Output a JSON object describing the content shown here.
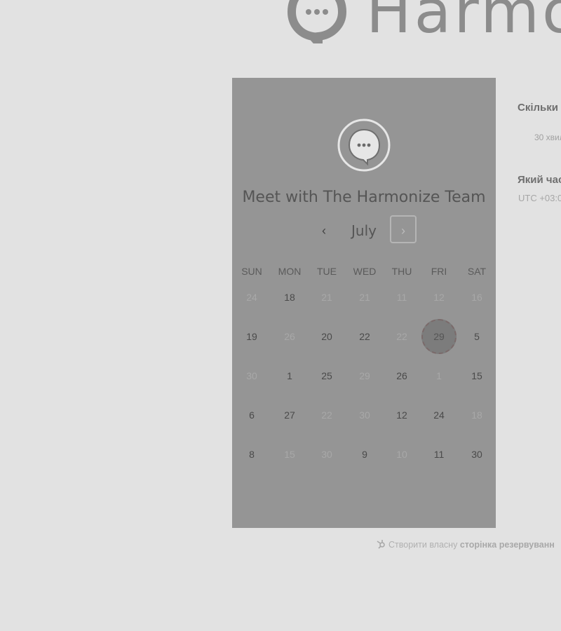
{
  "header": {
    "brand_text": "Harmo",
    "logo_icon": "chat-bubble-icon"
  },
  "card": {
    "title": "Meet with The Harmonize Team",
    "avatar_icon": "chat-bubble-icon",
    "month": "July",
    "prev_icon": "chevron-left-icon",
    "next_icon": "chevron-right-icon",
    "weekdays": [
      "SUN",
      "MON",
      "TUE",
      "WED",
      "THU",
      "FRI",
      "SAT"
    ],
    "weeks": [
      [
        {
          "d": "24",
          "on": false
        },
        {
          "d": "18",
          "on": true
        },
        {
          "d": "21",
          "on": false
        },
        {
          "d": "21",
          "on": false
        },
        {
          "d": "11",
          "on": false
        },
        {
          "d": "12",
          "on": false
        },
        {
          "d": "16",
          "on": false
        }
      ],
      [
        {
          "d": "19",
          "on": true
        },
        {
          "d": "26",
          "on": false
        },
        {
          "d": "20",
          "on": true
        },
        {
          "d": "22",
          "on": true
        },
        {
          "d": "22",
          "on": false
        },
        {
          "d": "29",
          "on": true,
          "selected": true
        },
        {
          "d": "5",
          "on": true
        }
      ],
      [
        {
          "d": "30",
          "on": false
        },
        {
          "d": "1",
          "on": true
        },
        {
          "d": "25",
          "on": true
        },
        {
          "d": "29",
          "on": false
        },
        {
          "d": "26",
          "on": true
        },
        {
          "d": "1",
          "on": false
        },
        {
          "d": "15",
          "on": true
        }
      ],
      [
        {
          "d": "6",
          "on": true
        },
        {
          "d": "27",
          "on": true
        },
        {
          "d": "22",
          "on": false
        },
        {
          "d": "30",
          "on": false
        },
        {
          "d": "12",
          "on": true
        },
        {
          "d": "24",
          "on": true
        },
        {
          "d": "18",
          "on": false
        }
      ],
      [
        {
          "d": "8",
          "on": true
        },
        {
          "d": "15",
          "on": false
        },
        {
          "d": "30",
          "on": false
        },
        {
          "d": "9",
          "on": true
        },
        {
          "d": "10",
          "on": false
        },
        {
          "d": "11",
          "on": true
        },
        {
          "d": "30",
          "on": true
        }
      ]
    ]
  },
  "panel": {
    "question_duration": "Скільки",
    "duration_option": "30 хвил",
    "question_time": "Який час",
    "timezone": "UTC +03:0"
  },
  "footer": {
    "icon": "sprocket-icon",
    "text": "Створити власну",
    "bold_text": "сторінка резервуванн"
  },
  "colors": {
    "page_bg": "#e2e2e2",
    "card_bg": "#959595",
    "selected_day": "#7c7c7c"
  }
}
